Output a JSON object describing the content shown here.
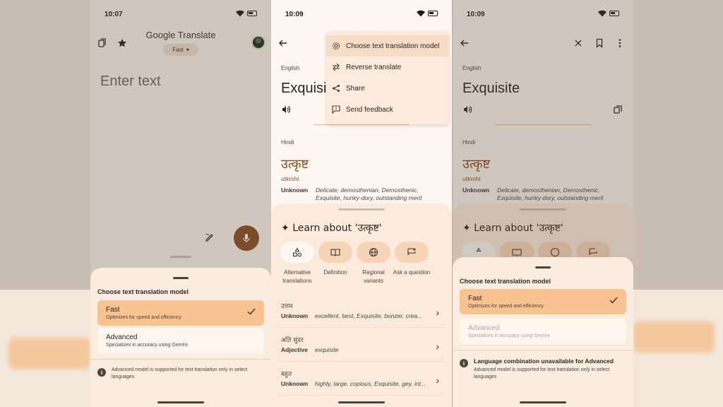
{
  "panel1": {
    "status_time": "10:07",
    "app_title_google": "Google",
    "app_title_translate": "Translate",
    "model_chip": "Fast",
    "placeholder": "Enter text",
    "sheet": {
      "title": "Choose text translation model",
      "options": [
        {
          "title": "Fast",
          "desc": "Optimizes for speed and efficiency",
          "selected": true
        },
        {
          "title": "Advanced",
          "desc": "Specializes in accuracy using Gemini",
          "selected": false
        }
      ],
      "note": "Advanced model is supported for text translation only in select languages"
    }
  },
  "panel2": {
    "status_time": "10:09",
    "source_lang": "English",
    "source_word": "Exquisite",
    "target_lang": "Hindi",
    "target_word": "उत्कृष्ट",
    "transliteration": "utkrsht",
    "pos": "Unknown",
    "synonyms": "Delicate, demosthenian, Demosthenic, Exquisite, hunky-dory, outstanding merit",
    "menu": [
      {
        "label": "Choose text translation model",
        "icon": "gear-icon"
      },
      {
        "label": "Reverse translate",
        "icon": "swap-icon"
      },
      {
        "label": "Share",
        "icon": "share-icon"
      },
      {
        "label": "Send feedback",
        "icon": "feedback-icon"
      }
    ],
    "learn": {
      "title": "Learn about 'उत्कृष्ट'",
      "chips": [
        {
          "label": "Alternative translations",
          "icon": "shapes-icon"
        },
        {
          "label": "Definition",
          "icon": "book-icon"
        },
        {
          "label": "Regional variants",
          "icon": "globe-icon"
        },
        {
          "label": "Ask a question",
          "icon": "question-icon"
        }
      ],
      "rows": [
        {
          "word": "उत्तम",
          "pos": "Unknown",
          "syn": "excellent, best, Exquisite, bonzer, crea..."
        },
        {
          "word": "अति सुंदर",
          "pos": "Adjective",
          "syn": "exquisite"
        },
        {
          "word": "बहुत",
          "pos": "Unknown",
          "syn": "highly, large, copious, Exquisite, gey, int..."
        }
      ]
    }
  },
  "panel3": {
    "status_time": "10:09",
    "source_lang": "English",
    "source_word": "Exquisite",
    "target_lang": "Hindi",
    "target_word": "उत्कृष्ट",
    "transliteration": "utkrsht",
    "pos": "Unknown",
    "synonyms": "Delicate, demosthenian, Demosthenic, Exquisite, hunky-dory, outstanding merit",
    "learn_title": "Learn about 'उत्कृष्ट'",
    "sheet": {
      "title": "Choose text translation model",
      "options": [
        {
          "title": "Fast",
          "desc": "Optimizes for speed and efficiency",
          "selected": true
        },
        {
          "title": "Advanced",
          "desc": "Specializes in accuracy using Gemini",
          "selected": false,
          "disabled": true
        }
      ],
      "note_head": "Language combination unavailable for Advanced",
      "note": "Advanced model is supported for text translation only in select languages"
    }
  }
}
